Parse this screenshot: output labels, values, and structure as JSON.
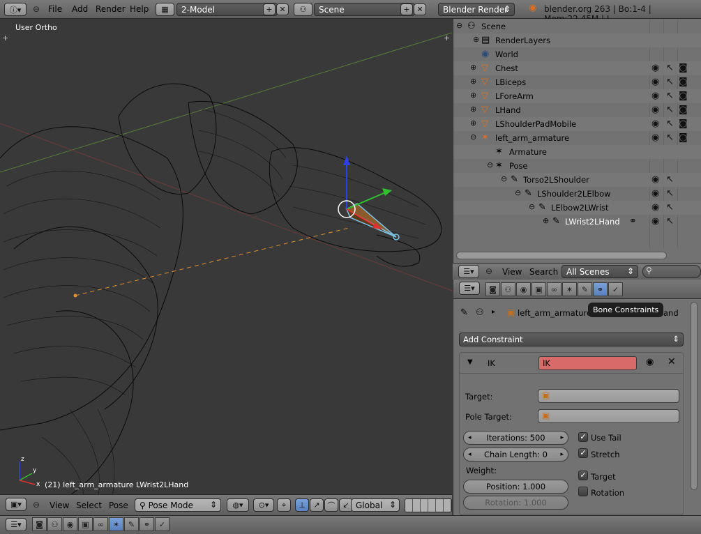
{
  "topbar": {
    "menus": [
      "File",
      "Add",
      "Render",
      "Help"
    ],
    "screen_layout": "2-Model",
    "scene": "Scene",
    "render_engine": "Blender Render",
    "status": "blender.org 263 | Bo:1-4 | Mem:22.45M | L..."
  },
  "viewport": {
    "view_label": "User Ortho",
    "status": "(21) left_arm_armature LWrist2LHand",
    "header": {
      "menus": [
        "View",
        "Select",
        "Pose"
      ],
      "mode": "Pose Mode",
      "orientation": "Global"
    }
  },
  "outliner": {
    "rows": [
      {
        "name": "Scene",
        "icon": "scene-icon"
      },
      {
        "name": "RenderLayers",
        "icon": "renderlayers-icon"
      },
      {
        "name": "World",
        "icon": "world-icon"
      },
      {
        "name": "Chest",
        "icon": "mesh-icon"
      },
      {
        "name": "LBiceps",
        "icon": "mesh-icon"
      },
      {
        "name": "LForeArm",
        "icon": "mesh-icon"
      },
      {
        "name": "LHand",
        "icon": "mesh-icon"
      },
      {
        "name": "LShoulderPadMobile",
        "icon": "mesh-icon"
      },
      {
        "name": "left_arm_armature",
        "icon": "armature-icon"
      },
      {
        "name": "Armature",
        "icon": "armature-data-icon"
      },
      {
        "name": "Pose",
        "icon": "pose-icon"
      },
      {
        "name": "Torso2LShoulder",
        "icon": "bone-icon"
      },
      {
        "name": "LShoulder2LElbow",
        "icon": "bone-icon"
      },
      {
        "name": "LElbow2LWrist",
        "icon": "bone-icon"
      },
      {
        "name": "LWrist2LHand",
        "icon": "bone-icon"
      }
    ],
    "header": {
      "menus": [
        "View",
        "Search"
      ],
      "filter": "All Scenes"
    }
  },
  "properties": {
    "tooltip": "Bone Constraints",
    "breadcrumb_object": "left_arm_armature",
    "breadcrumb_bone": "LWrist2LHand",
    "add_constraint": "Add Constraint",
    "constraint": {
      "type": "IK",
      "name": "IK",
      "target_label": "Target:",
      "pole_label": "Pole Target:",
      "iterations": "Iterations: 500",
      "chain_length": "Chain Length: 0",
      "weight_label": "Weight:",
      "position": "Position: 1.000",
      "rotation": "Rotation: 1.000",
      "use_tail": "Use Tail",
      "stretch": "Stretch",
      "target_check": "Target",
      "rotation_check": "Rotation"
    }
  },
  "colors": {
    "accent": "#5a80c0",
    "ik_name_bg": "#d96a6a",
    "selected_bone": "#7ac0e0"
  }
}
